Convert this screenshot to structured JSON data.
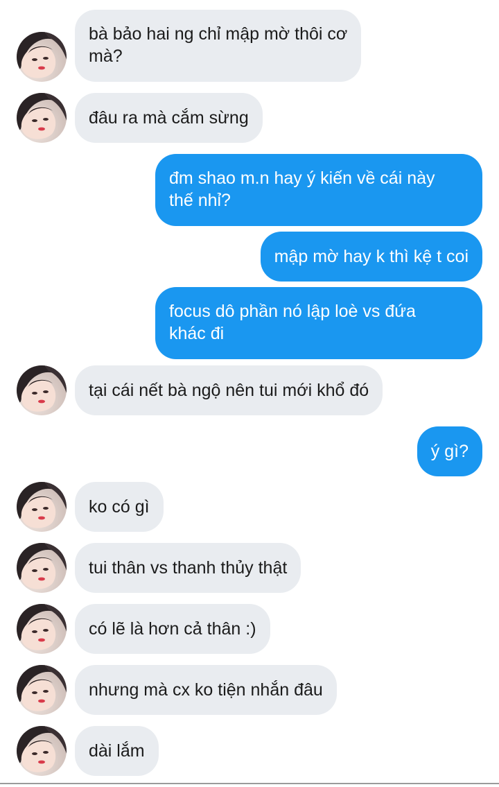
{
  "colors": {
    "incoming_bubble": "#e9ecf0",
    "outgoing_bubble": "#1a97f0",
    "incoming_text": "#1b1b1b",
    "outgoing_text": "#ffffff"
  },
  "messages": [
    {
      "from": "contact",
      "lines": [
        "bà bảo hai ng chỉ mập mờ thôi cơ",
        "mà?"
      ]
    },
    {
      "from": "contact",
      "lines": [
        "đâu ra mà cắm sừng"
      ]
    },
    {
      "from": "me",
      "lines": [
        "đm shao m.n hay ý kiến về cái này",
        "thế nhỉ?"
      ]
    },
    {
      "from": "me",
      "lines": [
        "mập mờ hay k thì kệ t coi"
      ]
    },
    {
      "from": "me",
      "lines": [
        "focus dô phần nó lập loè vs đứa",
        "khác đi"
      ]
    },
    {
      "from": "contact",
      "lines": [
        "tại cái nết bà ngộ nên tui mới khổ đó"
      ]
    },
    {
      "from": "me",
      "lines": [
        "ý gì?"
      ]
    },
    {
      "from": "contact",
      "lines": [
        "ko có gì"
      ]
    },
    {
      "from": "contact",
      "lines": [
        "tui thân vs thanh thủy thật"
      ]
    },
    {
      "from": "contact",
      "lines": [
        "có lẽ là hơn cả thân :)"
      ]
    },
    {
      "from": "contact",
      "lines": [
        "nhưng mà cx ko tiện nhắn đâu"
      ]
    },
    {
      "from": "contact",
      "lines": [
        "dài lắm"
      ]
    }
  ]
}
